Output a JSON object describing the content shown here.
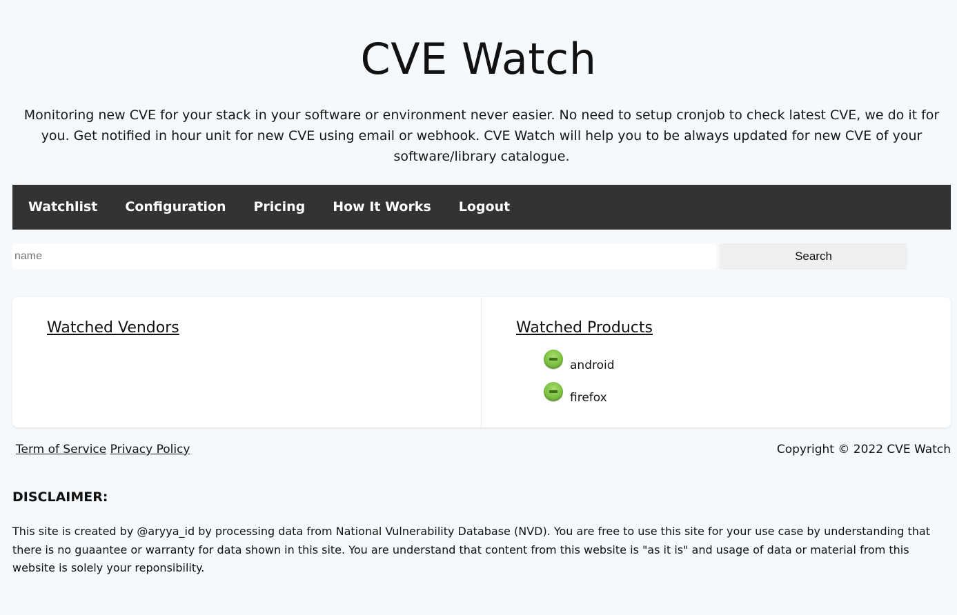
{
  "header": {
    "title": "CVE Watch",
    "intro": "Monitoring new CVE for your stack in your software or environment never easier. No need to setup cronjob to check latest CVE, we do it for you. Get notified in hour unit for new CVE using email or webhook. CVE Watch will help you to be always updated for new CVE of your software/library catalogue."
  },
  "nav": {
    "items": [
      {
        "label": "Watchlist"
      },
      {
        "label": "Configuration"
      },
      {
        "label": "Pricing"
      },
      {
        "label": "How It Works"
      },
      {
        "label": "Logout"
      }
    ]
  },
  "search": {
    "placeholder": "name",
    "value": "",
    "button_label": "Search"
  },
  "watched_vendors": {
    "heading": "Watched Vendors",
    "items": []
  },
  "watched_products": {
    "heading": "Watched Products",
    "items": [
      {
        "name": "android",
        "icon": "remove-icon"
      },
      {
        "name": "firefox",
        "icon": "remove-icon"
      }
    ]
  },
  "footer": {
    "terms_label": "Term of Service",
    "privacy_label": "Privacy Policy",
    "copyright": "Copyright © 2022 CVE Watch"
  },
  "disclaimer": {
    "title": "DISCLAIMER:",
    "text": "This site is created by @aryya_id by processing data from National Vulnerability Database (NVD). You are free to use this site for your use case by understanding that there is no guaantee or warranty for data shown in this site. You are understand that content from this website is \"as it is\" and usage of data or material from this website is solely your reponsibility."
  },
  "colors": {
    "page_bg": "#f5f9fc",
    "navbar_bg": "#333333",
    "nav_text": "#ffffff",
    "icon_green": "#7cc043"
  }
}
